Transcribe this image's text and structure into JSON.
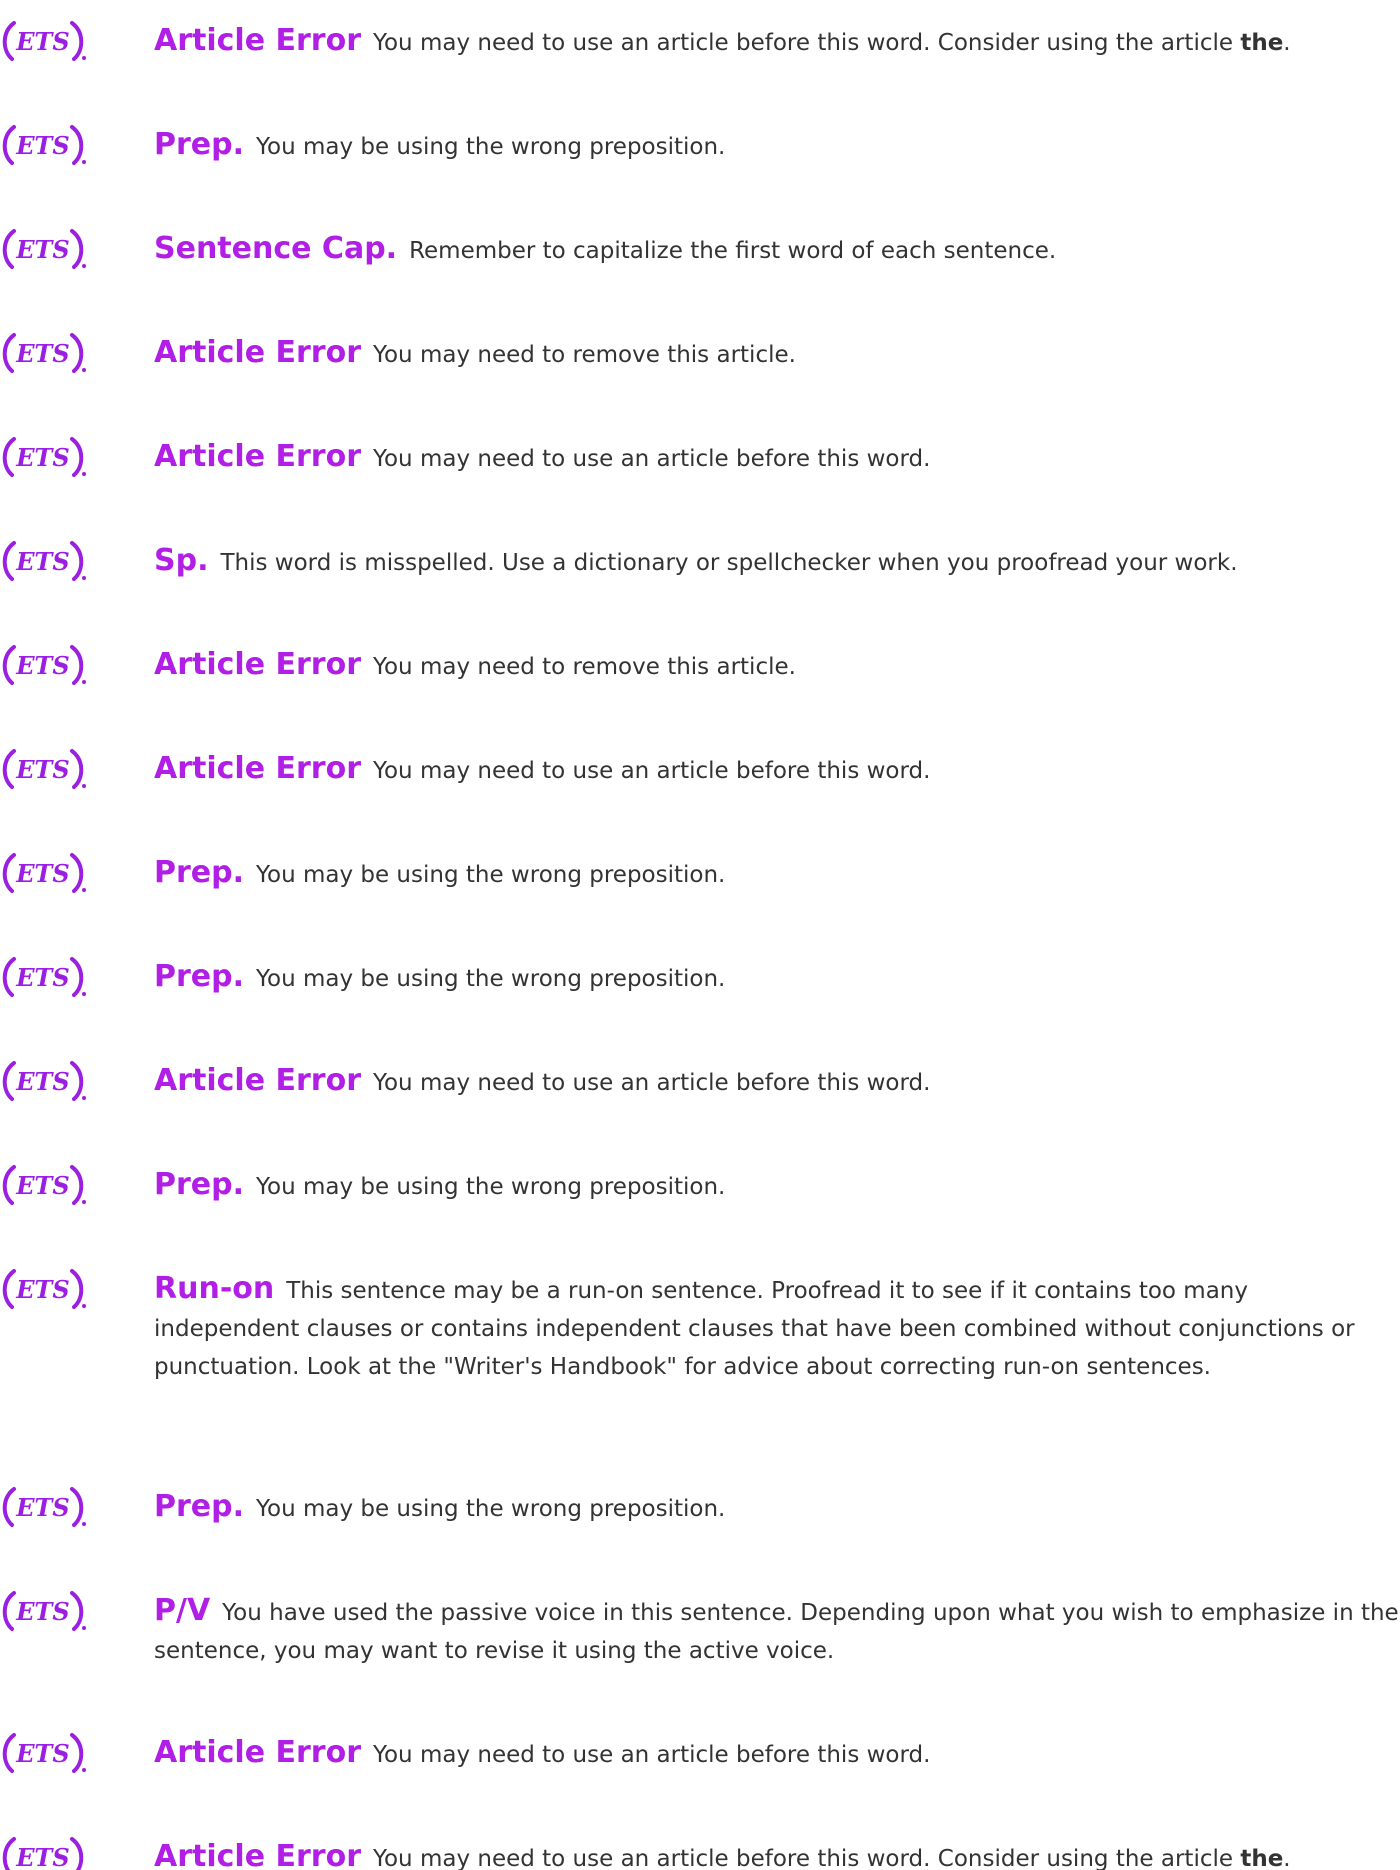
{
  "brand": {
    "logo_text": "ETS",
    "accent_color": "#9B1FE0",
    "title_color": "#B11EE6"
  },
  "feedback": [
    {
      "title": "Article Error",
      "message": "You may need to use an article before this word. Consider using the article",
      "emphasis": "the",
      "trail": "."
    },
    {
      "title": "Prep.",
      "message": "You may be using the wrong preposition.",
      "emphasis": "",
      "trail": ""
    },
    {
      "title": "Sentence Cap.",
      "message": "Remember to capitalize the first word of each sentence.",
      "emphasis": "",
      "trail": ""
    },
    {
      "title": "Article Error",
      "message": "You may need to remove this article.",
      "emphasis": "",
      "trail": ""
    },
    {
      "title": "Article Error",
      "message": "You may need to use an article before this word.",
      "emphasis": "",
      "trail": ""
    },
    {
      "title": "Sp.",
      "message": "This word is misspelled. Use a dictionary or spellchecker when you proofread your work.",
      "emphasis": "",
      "trail": ""
    },
    {
      "title": "Article Error",
      "message": "You may need to remove this article.",
      "emphasis": "",
      "trail": ""
    },
    {
      "title": "Article Error",
      "message": "You may need to use an article before this word.",
      "emphasis": "",
      "trail": ""
    },
    {
      "title": "Prep.",
      "message": "You may be using the wrong preposition.",
      "emphasis": "",
      "trail": ""
    },
    {
      "title": "Prep.",
      "message": "You may be using the wrong preposition.",
      "emphasis": "",
      "trail": ""
    },
    {
      "title": "Article Error",
      "message": "You may need to use an article before this word.",
      "emphasis": "",
      "trail": ""
    },
    {
      "title": "Prep.",
      "message": "You may be using the wrong preposition.",
      "emphasis": "",
      "trail": ""
    },
    {
      "title": "Run-on",
      "message": "This sentence may be a run-on sentence. Proofread it to see if it contains too many independent clauses or contains independent clauses that have been combined without conjunctions or punctuation. Look at the \"Writer's Handbook\" for advice about correcting run-on sentences.",
      "emphasis": "",
      "trail": ""
    },
    {
      "title": "Prep.",
      "message": "You may be using the wrong preposition.",
      "emphasis": "",
      "trail": ""
    },
    {
      "title": "P/V",
      "message": "You have used the passive voice in this sentence. Depending upon what you wish to emphasize in the sentence, you may want to revise it using the active voice.",
      "emphasis": "",
      "trail": ""
    },
    {
      "title": "Article Error",
      "message": "You may need to use an article before this word.",
      "emphasis": "",
      "trail": ""
    },
    {
      "title": "Article Error",
      "message": "You may need to use an article before this word. Consider using the article",
      "emphasis": "the",
      "trail": "."
    }
  ]
}
